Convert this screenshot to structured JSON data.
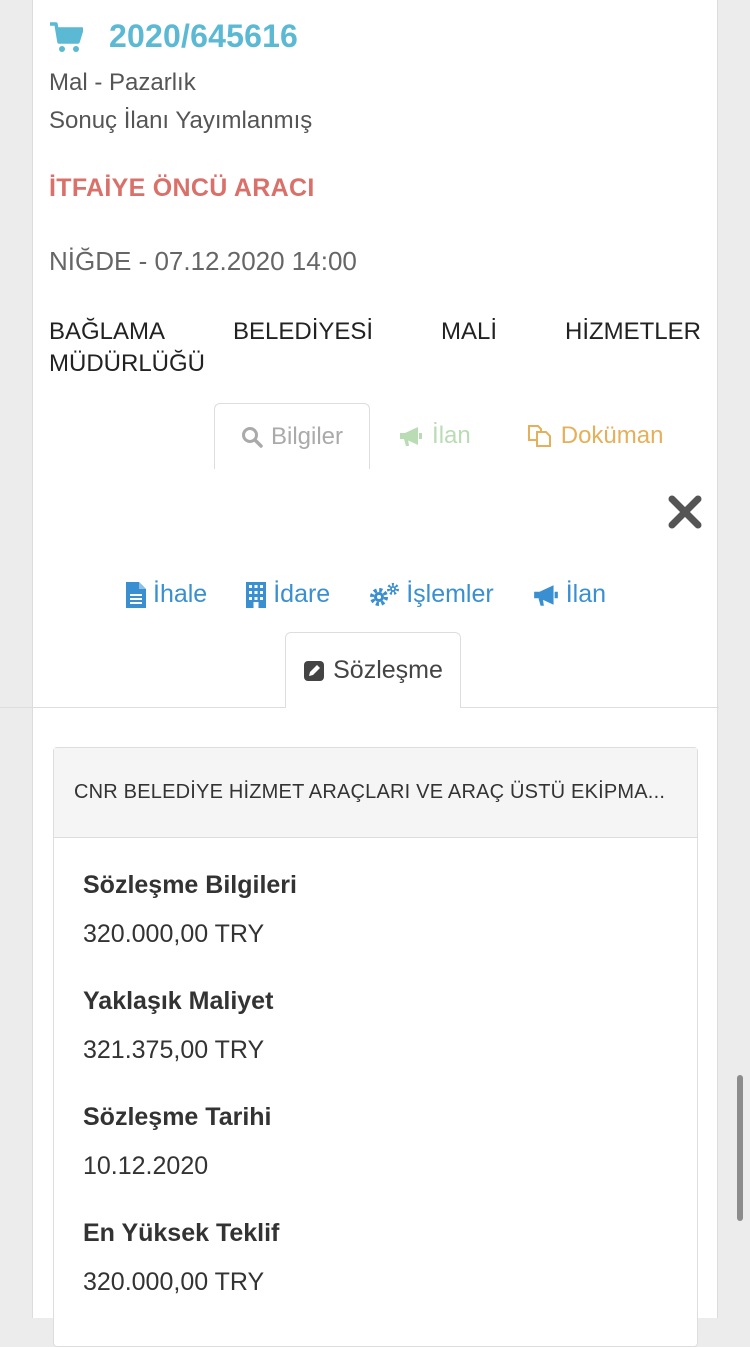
{
  "header": {
    "icon": "shopping-cart-icon",
    "tender_number": "2020/645616",
    "type": "Mal - Pazarlık",
    "status": "Sonuç İlanı Yayımlanmış",
    "title": "İTFAİYE ÖNCÜ ARACI",
    "location_date": "NİĞDE - 07.12.2020 14:00",
    "organization_words": [
      "BAĞLAMA",
      "BELEDİYESİ",
      "MALİ",
      "HİZMETLER"
    ],
    "organization_line2": "MÜDÜRLÜĞÜ",
    "accent_color": "#5bb9d4",
    "title_color": "#d9716a"
  },
  "top_tabs": {
    "bilgiler": "Bilgiler",
    "ilan": "İlan",
    "dokuman": "Doküman"
  },
  "detail_tabs": {
    "ihale": "İhale",
    "idare": "İdare",
    "islemler": "İşlemler",
    "ilan": "İlan",
    "sozlesme": "Sözleşme"
  },
  "panel": {
    "heading": "CNR BELEDİYE HİZMET ARAÇLARI VE ARAÇ ÜSTÜ EKİPMA...",
    "fields": [
      {
        "label": "Sözleşme Bilgileri",
        "value": "320.000,00 TRY"
      },
      {
        "label": "Yaklaşık Maliyet",
        "value": "321.375,00 TRY"
      },
      {
        "label": "Sözleşme Tarihi",
        "value": "10.12.2020"
      },
      {
        "label": "En Yüksek Teklif",
        "value": "320.000,00 TRY"
      }
    ]
  }
}
